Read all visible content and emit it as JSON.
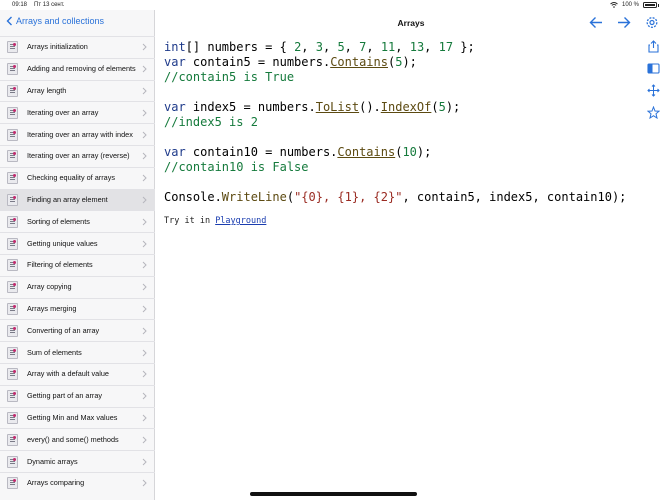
{
  "status": {
    "time": "09:18",
    "date": "Пт 13 сент.",
    "battery": "100 %"
  },
  "sidebar": {
    "back_label": "Arrays and collections",
    "items": [
      {
        "label": "Arrays initialization"
      },
      {
        "label": "Adding and removing of elements"
      },
      {
        "label": "Array length"
      },
      {
        "label": "Iterating over an array"
      },
      {
        "label": "Iterating over an array with index"
      },
      {
        "label": "Iterating over an array (reverse)"
      },
      {
        "label": "Checking equality of arrays"
      },
      {
        "label": "Finding an array element",
        "selected": true
      },
      {
        "label": "Sorting of elements"
      },
      {
        "label": "Getting unique values"
      },
      {
        "label": "Filtering of elements"
      },
      {
        "label": "Array copying"
      },
      {
        "label": "Arrays merging"
      },
      {
        "label": "Converting of an array"
      },
      {
        "label": "Sum of elements"
      },
      {
        "label": "Array with a default value"
      },
      {
        "label": "Getting part of an array"
      },
      {
        "label": "Getting Min and Max values"
      },
      {
        "label": "every() and some() methods"
      },
      {
        "label": "Dynamic arrays"
      },
      {
        "label": "Arrays comparing"
      }
    ]
  },
  "header": {
    "title": "Arrays"
  },
  "code": {
    "l1": {
      "kw": "int",
      "a": "[] numbers = { ",
      "n1": "2",
      "c1": ", ",
      "n2": "3",
      "c2": ", ",
      "n3": "5",
      "c3": ", ",
      "n4": "7",
      "c4": ", ",
      "n5": "11",
      "c5": ", ",
      "n6": "13",
      "c6": ", ",
      "n7": "17",
      "end": " };"
    },
    "l2": {
      "kw": "var",
      "a": " contain5 = numbers.",
      "m": "Contains",
      "b": "(",
      "n": "5",
      "end": ");"
    },
    "l3": "//contain5 is True",
    "l4": {
      "kw": "var",
      "a": " index5 = numbers.",
      "m1": "ToList",
      "b": "().",
      "m2": "IndexOf",
      "c": "(",
      "n": "5",
      "end": ");"
    },
    "l5": "//index5 is 2",
    "l6": {
      "kw": "var",
      "a": " contain10 = numbers.",
      "m": "Contains",
      "b": "(",
      "n": "10",
      "end": ");"
    },
    "l7": "//contain10 is False",
    "l8": {
      "a": "Console.",
      "m": "WriteLine",
      "b": "(",
      "s": "\"{0}, {1}, {2}\"",
      "end": ", contain5, index5, contain10);"
    },
    "try_prefix": "Try it in ",
    "try_link": "Playground"
  }
}
